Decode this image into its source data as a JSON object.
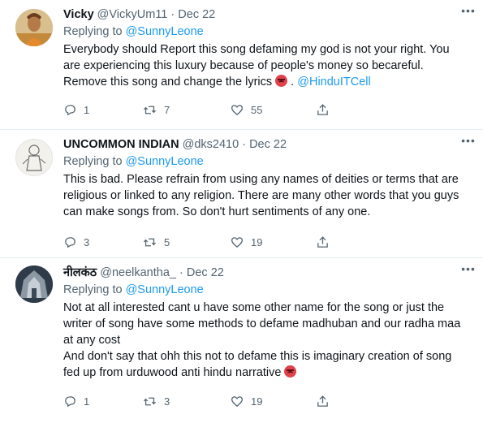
{
  "tweets": [
    {
      "name": "Vicky",
      "handle": "@VickyUm11",
      "date": "Dec 22",
      "replying_prefix": "Replying to ",
      "replying_to": "@SunnyLeone",
      "body_line1": "Everybody should Report this song defaming my god is not your right. You",
      "body_line2": "are experiencing this luxury because of people's money so becareful.",
      "body_line3": "Remove this song and change the lyrics ",
      "body_mention": "@HinduITCell",
      "emoji": "angry-face-emoji",
      "replies": "1",
      "retweets": "7",
      "likes": "55"
    },
    {
      "name": "UNCOMMON INDIAN",
      "handle": "@dks2410",
      "date": "Dec 22",
      "replying_prefix": "Replying to ",
      "replying_to": "@SunnyLeone",
      "body_line1": "This is bad. Please refrain from using any names of deities or terms that are",
      "body_line2": "religious or linked to any religion. There are many other words that you guys",
      "body_line3": "can make songs from. So don't hurt sentiments of any one.",
      "replies": "3",
      "retweets": "5",
      "likes": "19"
    },
    {
      "name": "नीलकंठ",
      "handle": "@neelkantha_",
      "date": "Dec 22",
      "replying_prefix": "Replying to ",
      "replying_to": "@SunnyLeone",
      "body_line1": "Not at all interested cant u have some other name for the song or just the",
      "body_line2": "writer of song have some methods to defame madhuban and our radha maa",
      "body_line3": "at any cost",
      "body_line4": "And don't say that ohh this not to defame this is imaginary creation of song",
      "body_line5": "fed up from urduwood anti hindu narrative ",
      "emoji": "angry-face-emoji",
      "replies": "1",
      "retweets": "3",
      "likes": "19"
    }
  ],
  "separator": "·",
  "colors": {
    "accent": "#1d9bf0",
    "secondary_text": "#536471",
    "divider": "#e6ecf0"
  },
  "icons": [
    "more-icon",
    "reply-icon",
    "retweet-icon",
    "like-icon",
    "share-icon"
  ]
}
